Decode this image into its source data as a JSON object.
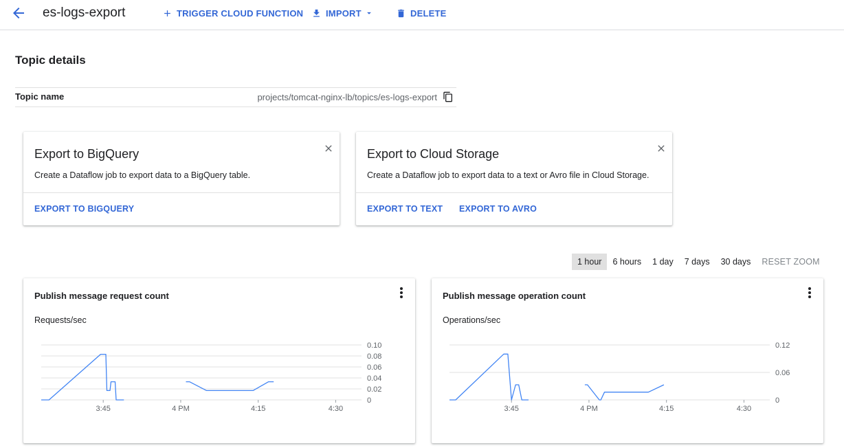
{
  "header": {
    "title": "es-logs-export",
    "actions": {
      "trigger": "TRIGGER CLOUD FUNCTION",
      "import": "IMPORT",
      "delete": "DELETE"
    }
  },
  "topic_details": {
    "title": "Topic details",
    "name_label": "Topic name",
    "name_value": "projects/tomcat-nginx-lb/topics/es-logs-export"
  },
  "export_cards": {
    "bigquery": {
      "title": "Export to BigQuery",
      "description": "Create a Dataflow job to export data to a BigQuery table.",
      "link": "EXPORT TO BIGQUERY"
    },
    "cloud_storage": {
      "title": "Export to Cloud Storage",
      "description": "Create a Dataflow job to export data to a text or Avro file in Cloud Storage.",
      "link_text": "EXPORT TO TEXT",
      "link_avro": "EXPORT TO AVRO"
    }
  },
  "time_range": {
    "options": [
      "1 hour",
      "6 hours",
      "1 day",
      "7 days",
      "30 days"
    ],
    "selected": "1 hour",
    "reset": "RESET ZOOM"
  },
  "colors": {
    "accent": "#3367d6",
    "line": "#4285f4",
    "grid": "#e0e0e0"
  },
  "icons": {
    "back": "arrow-back-icon",
    "trigger": "plus-icon",
    "import": "download-icon",
    "delete": "trash-icon",
    "copy": "copy-icon",
    "close": "close-icon",
    "menu": "more-vert-icon"
  },
  "chart_data": [
    {
      "type": "line",
      "title": "Publish message request count",
      "ylabel": "Requests/sec",
      "ylim": [
        0,
        0.1
      ],
      "yticks": [
        "0.10",
        "0.08",
        "0.06",
        "0.04",
        "0.02",
        "0"
      ],
      "ytick_values": [
        0.1,
        0.08,
        0.06,
        0.04,
        0.02,
        0
      ],
      "xticks": [
        "3:45",
        "4 PM",
        "4:15",
        "4:30"
      ],
      "xtick_minutes": [
        225,
        240,
        255,
        270
      ],
      "xlim_minutes": [
        213,
        275
      ],
      "grid": true,
      "segments": [
        [
          [
            213.0,
            0
          ],
          [
            214.5,
            0
          ],
          [
            224.5,
            0.083
          ],
          [
            225.5,
            0.083
          ],
          [
            225.7,
            0.017
          ],
          [
            226.3,
            0.017
          ],
          [
            226.5,
            0.033
          ],
          [
            227.3,
            0.033
          ],
          [
            227.5,
            0
          ],
          [
            229.0,
            0
          ]
        ],
        [
          [
            241.0,
            0.033
          ],
          [
            241.7,
            0.033
          ],
          [
            245.0,
            0.017
          ],
          [
            254.0,
            0.017
          ],
          [
            257.0,
            0.033
          ],
          [
            258.0,
            0.033
          ]
        ]
      ]
    },
    {
      "type": "line",
      "title": "Publish message operation count",
      "ylabel": "Operations/sec",
      "ylim": [
        0,
        0.12
      ],
      "yticks": [
        "0.12",
        "0.06",
        "0"
      ],
      "ytick_values": [
        0.12,
        0.06,
        0
      ],
      "xticks": [
        "3:45",
        "4 PM",
        "4:15",
        "4:30"
      ],
      "xtick_minutes": [
        225,
        240,
        255,
        270
      ],
      "xlim_minutes": [
        213,
        275
      ],
      "grid": true,
      "segments": [
        [
          [
            213.0,
            0
          ],
          [
            214.2,
            0
          ],
          [
            223.5,
            0.1
          ],
          [
            224.3,
            0.1
          ],
          [
            225.0,
            0
          ],
          [
            225.8,
            0.033
          ],
          [
            226.4,
            0.033
          ],
          [
            227.0,
            0
          ],
          [
            228.3,
            0
          ]
        ],
        [
          [
            239.2,
            0.033
          ],
          [
            239.7,
            0.033
          ],
          [
            242.0,
            0
          ],
          [
            242.3,
            0
          ],
          [
            243.0,
            0.017
          ],
          [
            251.5,
            0.017
          ],
          [
            254.5,
            0.033
          ]
        ]
      ]
    }
  ]
}
